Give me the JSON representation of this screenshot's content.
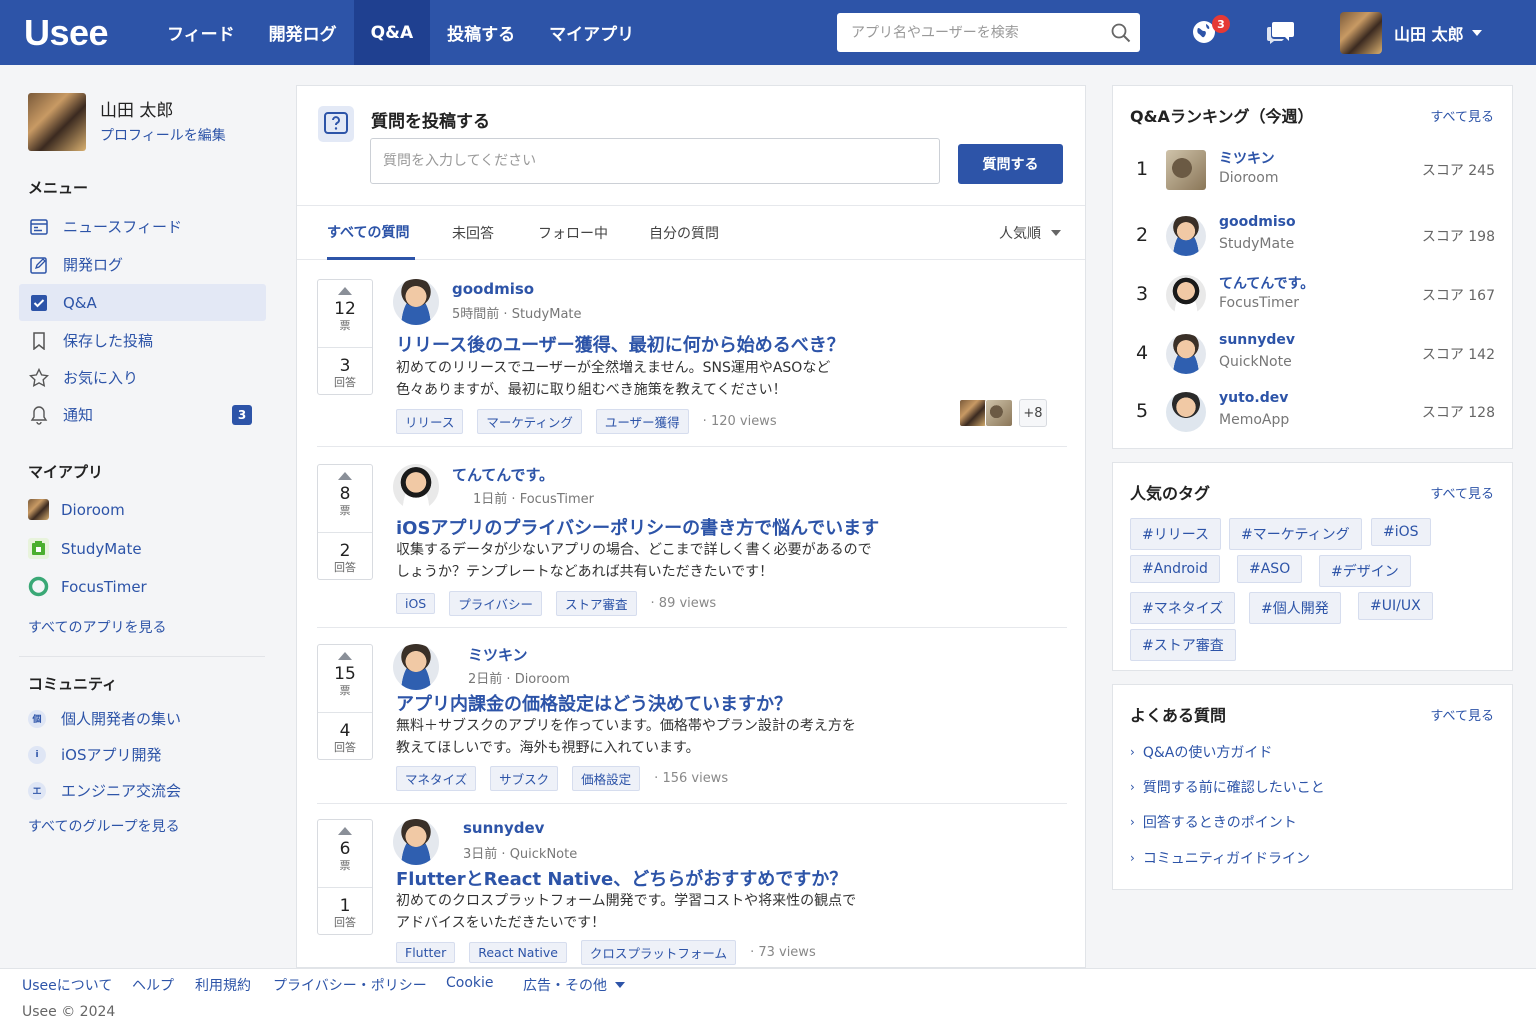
{
  "header": {
    "logo": "Usee",
    "nav": [
      "フィード",
      "開発ログ",
      "Q&A",
      "投稿する",
      "マイアプリ"
    ],
    "active_nav": "Q&A",
    "search_placeholder": "アプリ名やユーザーを検索",
    "notification_count": "3",
    "user_name": "山田 太郎"
  },
  "sidebar": {
    "user_name": "山田 太郎",
    "edit_profile": "プロフィールを編集",
    "menu_title": "メニュー",
    "menu": [
      {
        "label": "ニュースフィード",
        "icon": "newsfeed-icon"
      },
      {
        "label": "開発ログ",
        "icon": "edit-icon"
      },
      {
        "label": "Q&A",
        "icon": "checkbox-icon",
        "active": true
      },
      {
        "label": "保存した投稿",
        "icon": "bookmark-icon"
      },
      {
        "label": "お気に入り",
        "icon": "star-icon"
      },
      {
        "label": "通知",
        "icon": "bell-icon",
        "count": "3"
      }
    ],
    "apps_title": "マイアプリ",
    "apps": [
      "Dioroom",
      "StudyMate",
      "FocusTimer"
    ],
    "all_apps": "すべてのアプリを見る",
    "community_title": "コミュニティ",
    "groups": [
      {
        "label": "個人開発者の集い",
        "abbr": "個"
      },
      {
        "label": "iOSアプリ開発",
        "abbr": "i"
      },
      {
        "label": "エンジニア交流会",
        "abbr": "エ"
      }
    ],
    "all_groups": "すべてのグループを見る"
  },
  "ask": {
    "title": "質問を投稿する",
    "placeholder": "質問を入力してください",
    "button": "質問する"
  },
  "tabs": [
    "すべての質問",
    "未回答",
    "フォロー中",
    "自分の質問"
  ],
  "sort": "人気順",
  "questions": [
    {
      "votes": "12",
      "vote_label": "票",
      "answers": "3",
      "answer_label": "回答",
      "author": "goodmiso",
      "time": "5時間前",
      "app": "StudyMate",
      "title": "リリース後のユーザー獲得、最初に何から始めるべき？",
      "body1": "初めてのリリースでユーザーが全然増えません。SNS運用やASOなど",
      "body2": "色々ありますが、最初に取り組むべき施策を教えてください！",
      "tags": [
        "リリース",
        "マーケティング",
        "ユーザー獲得"
      ],
      "views": "120 views",
      "more": "+8"
    },
    {
      "votes": "8",
      "vote_label": "票",
      "answers": "2",
      "answer_label": "回答",
      "author": "てんてんです。",
      "time": "1日前",
      "app": "FocusTimer",
      "title": "iOSアプリのプライバシーポリシーの書き方で悩んでいます",
      "body1": "収集するデータが少ないアプリの場合、どこまで詳しく書く必要があるので",
      "body2": "しょうか？テンプレートなどあれば共有いただきたいです！",
      "tags": [
        "iOS",
        "プライバシー",
        "ストア審査"
      ],
      "views": "89 views"
    },
    {
      "votes": "15",
      "vote_label": "票",
      "answers": "4",
      "answer_label": "回答",
      "author": "ミツキン",
      "time": "2日前",
      "app": "Dioroom",
      "title": "アプリ内課金の価格設定はどう決めていますか？",
      "body1": "無料＋サブスクのアプリを作っています。価格帯やプラン設計の考え方を",
      "body2": "教えてほしいです。海外も視野に入れています。",
      "tags": [
        "マネタイズ",
        "サブスク",
        "価格設定"
      ],
      "views": "156 views"
    },
    {
      "votes": "6",
      "vote_label": "票",
      "answers": "1",
      "answer_label": "回答",
      "author": "sunnydev",
      "time": "3日前",
      "app": "QuickNote",
      "title": "FlutterとReact Native、どちらがおすすめですか？",
      "body1": "初めてのクロスプラットフォーム開発です。学習コストや将来性の観点で",
      "body2": "アドバイスをいただきたいです！",
      "tags": [
        "Flutter",
        "React Native",
        "クロスプラットフォーム"
      ],
      "views": "73 views"
    }
  ],
  "ranking": {
    "title": "Q&Aランキング（今週）",
    "see_all": "すべて見る",
    "items": [
      {
        "rank": "1",
        "name": "ミツキン",
        "app": "Dioroom",
        "score": "スコア 245"
      },
      {
        "rank": "2",
        "name": "goodmiso",
        "app": "StudyMate",
        "score": "スコア 198"
      },
      {
        "rank": "3",
        "name": "てんてんです。",
        "app": "FocusTimer",
        "score": "スコア 167"
      },
      {
        "rank": "4",
        "name": "sunnydev",
        "app": "QuickNote",
        "score": "スコア 142"
      },
      {
        "rank": "5",
        "name": "yuto.dev",
        "app": "MemoApp",
        "score": "スコア 128"
      }
    ]
  },
  "popular_tags": {
    "title": "人気のタグ",
    "see_all": "すべて見る",
    "tags": [
      "#リリース",
      "#マーケティング",
      "#iOS",
      "#Android",
      "#ASO",
      "#デザイン",
      "#マネタイズ",
      "#個人開発",
      "#UI/UX",
      "#ストア審査"
    ]
  },
  "faq": {
    "title": "よくある質問",
    "see_all": "すべて見る",
    "items": [
      "Q&Aの使い方ガイド",
      "質問する前に確認したいこと",
      "回答するときのポイント",
      "コミュニティガイドライン"
    ]
  },
  "footer": {
    "links": [
      "Useeについて",
      "ヘルプ",
      "利用規約",
      "プライバシー・ポリシー",
      "Cookie",
      "広告・その他"
    ],
    "copyright": "Usee © 2024"
  },
  "colors": {
    "brand": "#2d54a8",
    "brand_dark": "#1f4090",
    "badge": "#e53935"
  }
}
